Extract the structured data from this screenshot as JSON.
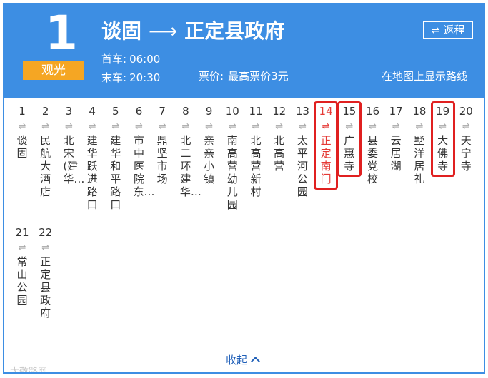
{
  "route": {
    "number": "1",
    "tag": "观光"
  },
  "title": {
    "from": "谈固",
    "arrow": "⟶",
    "to": "正定县政府"
  },
  "times": {
    "first_label": "首车:",
    "first_time": "06:00",
    "last_label": "末车:",
    "last_time": "20:30"
  },
  "fare": {
    "label": "票价:",
    "value": "最高票价3元"
  },
  "return_btn": {
    "label": "返程",
    "icon": "swap-icon"
  },
  "map_link": "在地图上显示路线",
  "switch_glyph": "⇌",
  "stops": [
    {
      "num": "1",
      "name": "谈固"
    },
    {
      "num": "2",
      "name": "民航大酒店"
    },
    {
      "num": "3",
      "name": "北宋(建华…"
    },
    {
      "num": "4",
      "name": "建华跃进路口"
    },
    {
      "num": "5",
      "name": "建华和平路口"
    },
    {
      "num": "6",
      "name": "市中医院东…"
    },
    {
      "num": "7",
      "name": "鼎坚市场"
    },
    {
      "num": "8",
      "name": "北二环建华…"
    },
    {
      "num": "9",
      "name": "亲亲小镇"
    },
    {
      "num": "10",
      "name": "南高营幼儿园"
    },
    {
      "num": "11",
      "name": "北高营新村"
    },
    {
      "num": "12",
      "name": "北高营"
    },
    {
      "num": "13",
      "name": "太平河公园"
    },
    {
      "num": "14",
      "name": "正定南门"
    },
    {
      "num": "15",
      "name": "广惠寺"
    },
    {
      "num": "16",
      "name": "县委党校"
    },
    {
      "num": "17",
      "name": "云居湖"
    },
    {
      "num": "18",
      "name": "墅洋居礼"
    },
    {
      "num": "19",
      "name": "大佛寺"
    },
    {
      "num": "20",
      "name": "天宁寺"
    },
    {
      "num": "21",
      "name": "常山公园"
    },
    {
      "num": "22",
      "name": "正定县政府"
    }
  ],
  "current_stop": 14,
  "highlighted_stops": [
    14,
    15,
    19
  ],
  "collapse_label": "收起",
  "watermark": "大敬路网",
  "colors": {
    "header": "#3d8ee3",
    "tag": "#f5a623",
    "highlight": "#e02020",
    "current": "#e53935",
    "link": "#1f5fb8"
  }
}
